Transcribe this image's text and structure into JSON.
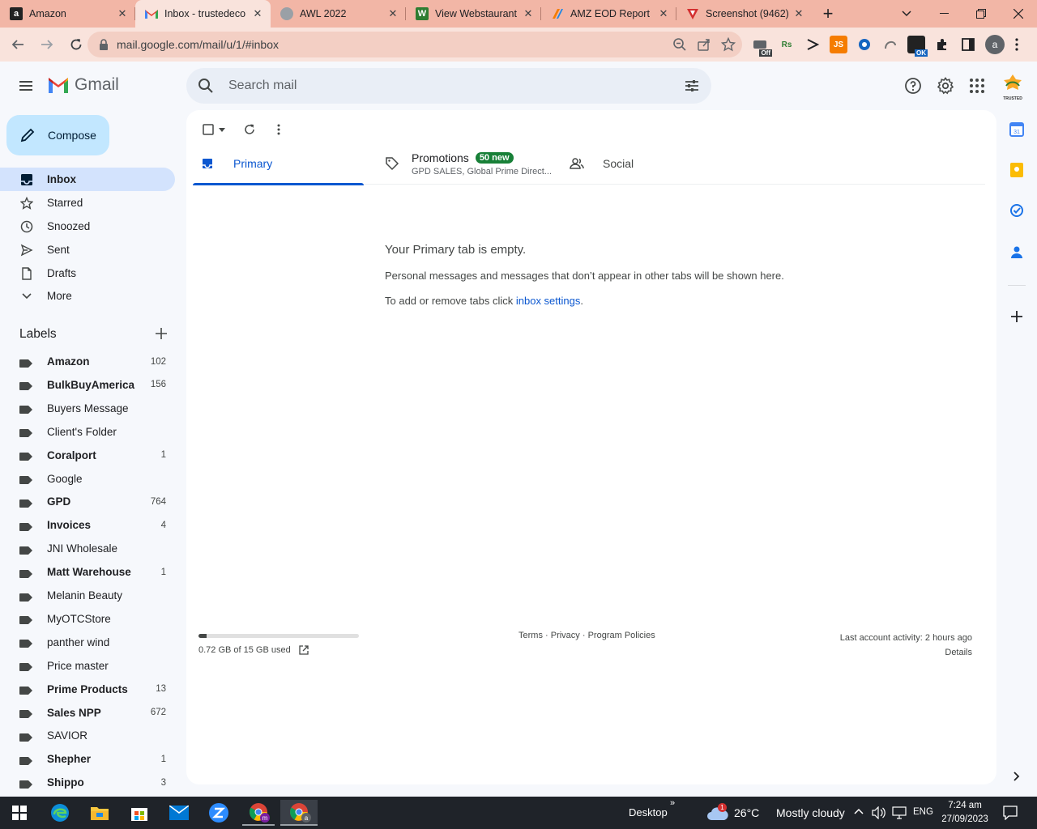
{
  "browser": {
    "tabs": [
      {
        "title": "Amazon",
        "favicon": "amazon-icon"
      },
      {
        "title": "Inbox - trustedeco",
        "favicon": "gmail-icon"
      },
      {
        "title": "AWL 2022",
        "favicon": "globe-icon"
      },
      {
        "title": "View Webstaurant",
        "favicon": "webstaurant-icon"
      },
      {
        "title": "AMZ EOD Report",
        "favicon": "report-icon"
      },
      {
        "title": "Screenshot (9462)",
        "favicon": "screenshot-icon"
      }
    ],
    "url": "mail.google.com/mail/u/1/#inbox",
    "profile_initial": "a",
    "ext_labels": {
      "off": "Off",
      "rs": "Rs",
      "js": "JS",
      "ok": "OK"
    }
  },
  "gmail": {
    "logo_text": "Gmail",
    "search_placeholder": "Search mail",
    "compose_label": "Compose",
    "nav": [
      {
        "label": "Inbox",
        "icon": "inbox-icon"
      },
      {
        "label": "Starred",
        "icon": "star-icon"
      },
      {
        "label": "Snoozed",
        "icon": "clock-icon"
      },
      {
        "label": "Sent",
        "icon": "send-icon"
      },
      {
        "label": "Drafts",
        "icon": "draft-icon"
      },
      {
        "label": "More",
        "icon": "chevron-down-icon"
      }
    ],
    "labels_title": "Labels",
    "labels": [
      {
        "name": "Amazon",
        "count": "102",
        "bold": true
      },
      {
        "name": "BulkBuyAmerica",
        "count": "156",
        "bold": true
      },
      {
        "name": "Buyers Message",
        "count": "",
        "bold": false
      },
      {
        "name": "Client's Folder",
        "count": "",
        "bold": false
      },
      {
        "name": "Coralport",
        "count": "1",
        "bold": true
      },
      {
        "name": "Google",
        "count": "",
        "bold": false
      },
      {
        "name": "GPD",
        "count": "764",
        "bold": true
      },
      {
        "name": "Invoices",
        "count": "4",
        "bold": true
      },
      {
        "name": "JNI Wholesale",
        "count": "",
        "bold": false
      },
      {
        "name": "Matt Warehouse",
        "count": "1",
        "bold": true
      },
      {
        "name": "Melanin Beauty",
        "count": "",
        "bold": false
      },
      {
        "name": "MyOTCStore",
        "count": "",
        "bold": false
      },
      {
        "name": "panther wind",
        "count": "",
        "bold": false
      },
      {
        "name": "Price master",
        "count": "",
        "bold": false
      },
      {
        "name": "Prime Products",
        "count": "13",
        "bold": true
      },
      {
        "name": "Sales NPP",
        "count": "672",
        "bold": true
      },
      {
        "name": "SAVIOR",
        "count": "",
        "bold": false
      },
      {
        "name": "Shepher",
        "count": "1",
        "bold": true
      },
      {
        "name": "Shippo",
        "count": "3",
        "bold": true
      }
    ],
    "category_tabs": {
      "primary": "Primary",
      "promotions": "Promotions",
      "promotions_badge": "50 new",
      "promotions_senders": "GPD SALES, Global Prime Direct...",
      "social": "Social"
    },
    "empty_state": {
      "title": "Your Primary tab is empty.",
      "line1": "Personal messages and messages that don’t appear in other tabs will be shown here.",
      "line2_prefix": "To add or remove tabs click ",
      "line2_link": "inbox settings",
      "line2_suffix": "."
    },
    "storage": {
      "text": "0.72 GB of 15 GB used",
      "used_fraction": 0.048
    },
    "footer": {
      "terms": "Terms",
      "privacy": "Privacy",
      "policies": "Program Policies",
      "sep": " · "
    },
    "activity": {
      "last": "Last account activity: 2 hours ago",
      "details": "Details"
    },
    "account_logo_text": "TRUSTED"
  },
  "taskbar": {
    "desktop_label": "Desktop",
    "weather_temp": "26°C",
    "weather_desc": "Mostly cloudy",
    "weather_alert": "1",
    "language": "ENG",
    "time": "7:24 am",
    "date": "27/09/2023",
    "chrome_badge": "m",
    "chrome2_badge": "a"
  },
  "colors": {
    "tabstrip": "#f2b6a6",
    "toolbar": "#f9e3dc",
    "gmail_bg": "#f6f8fc",
    "compose": "#c2e7ff",
    "active_nav": "#d3e3fd",
    "accent_blue": "#0b57d0",
    "badge_green": "#188038"
  }
}
